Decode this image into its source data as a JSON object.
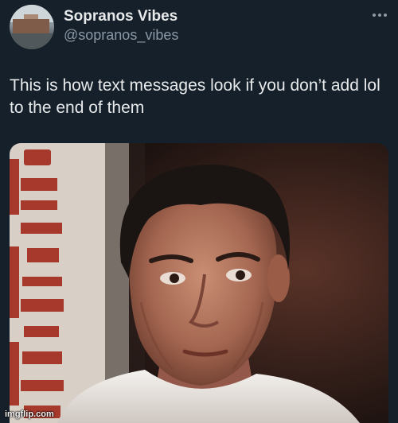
{
  "tweet": {
    "author": {
      "display_name": "Sopranos Vibes",
      "handle": "@sopranos_vibes",
      "avatar_icon": "avatar-photo"
    },
    "menu_icon": "more-options-icon",
    "text": "This is how text messages look if you don’t add lol to the end of them",
    "media": {
      "kind": "photo",
      "poster_text": "ATTIES"
    },
    "watermark": "imgflip.com"
  },
  "colors": {
    "background": "#15202b",
    "primary_text": "#e7e9ea",
    "secondary_text": "#8b98a5"
  }
}
